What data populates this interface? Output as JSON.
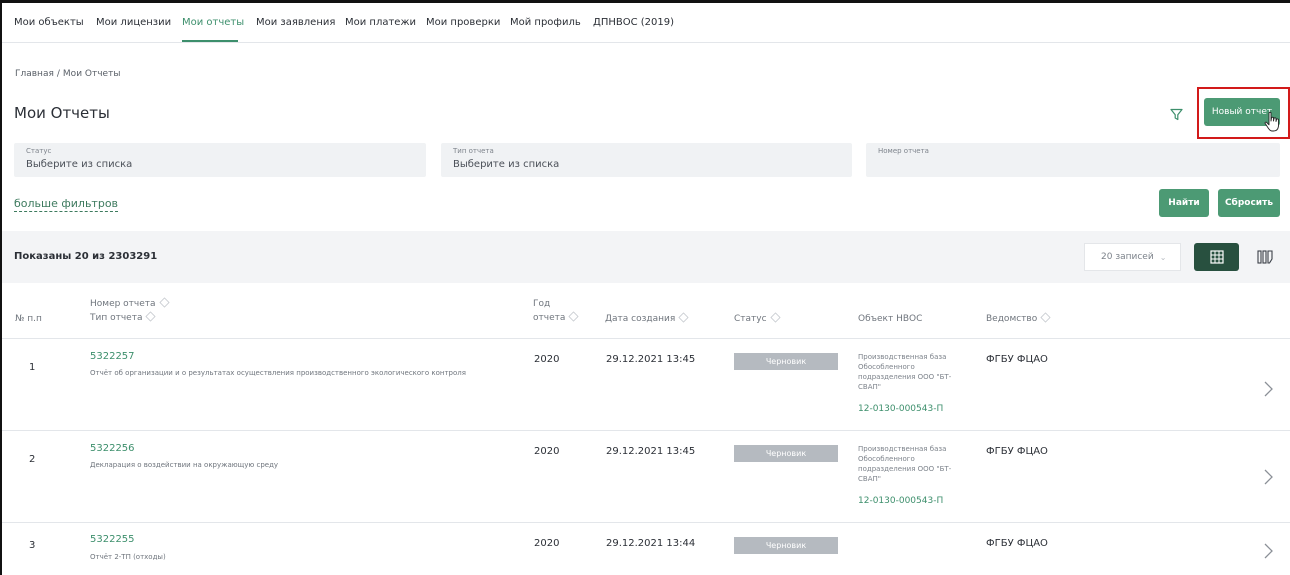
{
  "nav": {
    "items": [
      {
        "label": "Мои объекты"
      },
      {
        "label": "Мои лицензии"
      },
      {
        "label": "Мои отчеты"
      },
      {
        "label": "Мои заявления"
      },
      {
        "label": "Мои платежи"
      },
      {
        "label": "Мои проверки"
      },
      {
        "label": "Мой профиль"
      },
      {
        "label": "ДПНВОС (2019)"
      }
    ],
    "active_index": 2
  },
  "breadcrumb": {
    "home": "Главная",
    "separator": "/",
    "current": "Мои Отчеты"
  },
  "page": {
    "title": "Мои Отчеты",
    "new_report_button": "Новый отчет",
    "filter_icon": "filter-icon"
  },
  "filters": {
    "status": {
      "label": "Статус",
      "value": "Выберите из списка"
    },
    "report_type": {
      "label": "Тип отчета",
      "value": "Выберите из списка"
    },
    "report_number": {
      "label": "Номер отчета",
      "value": ""
    },
    "more_filters": "больше фильтров",
    "find_button": "Найти",
    "reset_button": "Сбросить"
  },
  "summary": {
    "text": "Показаны 20 из 2303291",
    "per_page": "20 записей"
  },
  "table": {
    "headers": {
      "num": "№ п.п",
      "report_number": "Номер отчета",
      "report_type": "Тип отчета",
      "year_line1": "Год",
      "year_line2": "отчета",
      "created": "Дата создания",
      "status": "Статус",
      "object": "Объект НВОС",
      "department": "Ведомство"
    },
    "rows": [
      {
        "index": "1",
        "number": "5322257",
        "type": "Отчёт об организации и о результатах осуществления производственного экологического контроля",
        "year": "2020",
        "created": "29.12.2021 13:45",
        "status": "Черновик",
        "object_lines": [
          "Производственная база",
          "Обособленного",
          "подразделения ООО \"БТ-",
          "СВАП\""
        ],
        "object_code": "12-0130-000543-П",
        "department": "ФГБУ ФЦАО"
      },
      {
        "index": "2",
        "number": "5322256",
        "type": "Декларация о воздействии на окружающую среду",
        "year": "2020",
        "created": "29.12.2021 13:45",
        "status": "Черновик",
        "object_lines": [
          "Производственная база",
          "Обособленного",
          "подразделения ООО \"БТ-",
          "СВАП\""
        ],
        "object_code": "12-0130-000543-П",
        "department": "ФГБУ ФЦАО"
      },
      {
        "index": "3",
        "number": "5322255",
        "type": "Отчёт 2-ТП (отходы)",
        "year": "2020",
        "created": "29.12.2021 13:44",
        "status": "Черновик",
        "object_lines": [],
        "object_code": "",
        "department": "ФГБУ ФЦАО"
      }
    ]
  },
  "colors": {
    "accent": "#3d8f6c",
    "button": "#4c9a74",
    "highlight": "#d21a1a",
    "badge": "#b5bac0"
  }
}
